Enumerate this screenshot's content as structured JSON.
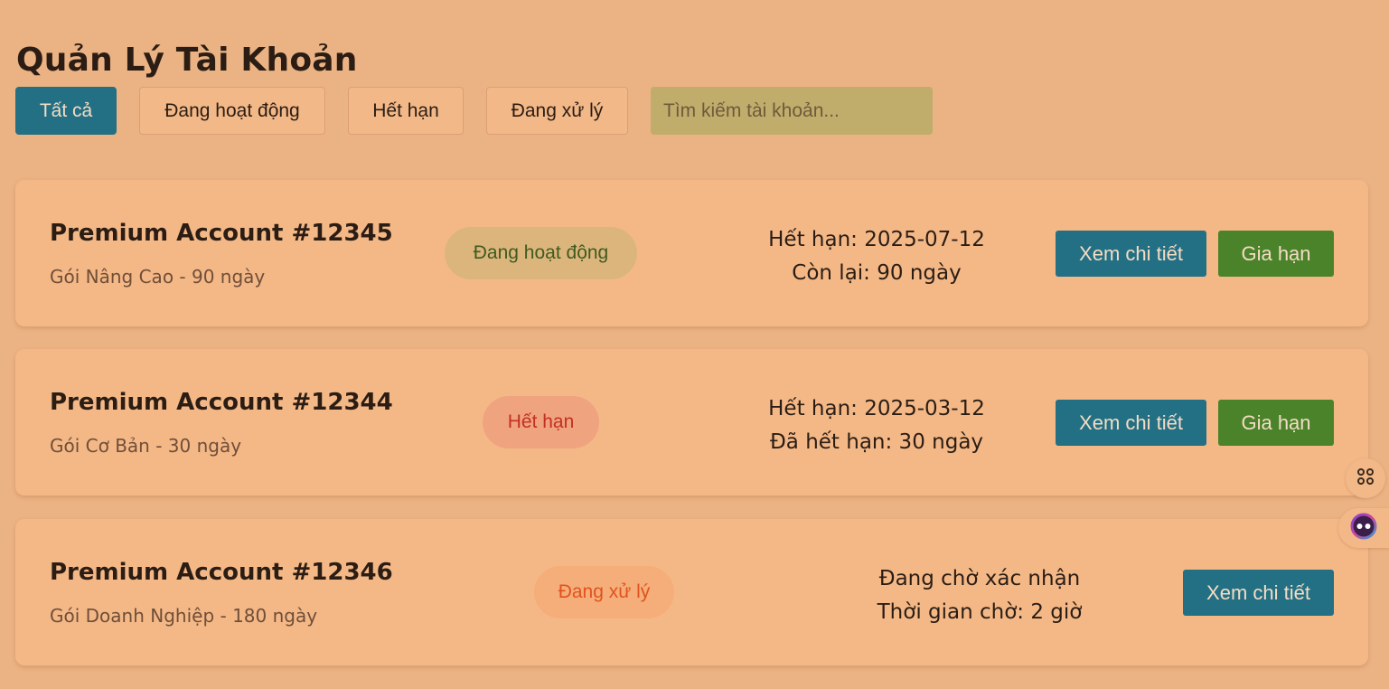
{
  "header": {
    "title": "Quản Lý Tài Khoản"
  },
  "filters": {
    "items": [
      {
        "label": "Tất cả",
        "active": true
      },
      {
        "label": "Đang hoạt động",
        "active": false
      },
      {
        "label": "Hết hạn",
        "active": false
      },
      {
        "label": "Đang xử lý",
        "active": false
      }
    ],
    "search_placeholder": "Tìm kiếm tài khoản..."
  },
  "accounts": [
    {
      "title": "Premium Account #12345",
      "plan": "Gói Nâng Cao - 90 ngày",
      "status": "Đang hoạt động",
      "status_type": "active",
      "info_line1": "Hết hạn: 2025-07-12",
      "info_line2": "Còn lại: 90 ngày",
      "detail_label": "Xem chi tiết",
      "renew_label": "Gia hạn"
    },
    {
      "title": "Premium Account #12344",
      "plan": "Gói Cơ Bản - 30 ngày",
      "status": "Hết hạn",
      "status_type": "expired",
      "info_line1": "Hết hạn: 2025-03-12",
      "info_line2": "Đã hết hạn: 30 ngày",
      "detail_label": "Xem chi tiết",
      "renew_label": "Gia hạn"
    },
    {
      "title": "Premium Account #12346",
      "plan": "Gói Doanh Nghiệp - 180 ngày",
      "status": "Đang xử lý",
      "status_type": "pending",
      "info_line1": "Đang chờ xác nhận",
      "info_line2": "Thời gian chờ: 2 giờ",
      "detail_label": "Xem chi tiết"
    }
  ],
  "side_tools": [
    {
      "icon": "apps-grid-icon"
    },
    {
      "icon": "assistant-face-icon"
    }
  ],
  "colors": {
    "background": "#ebb283",
    "card": "#f4b887",
    "primary": "#237085",
    "success": "#4b832b",
    "search": "#c0ac6b",
    "status_active_text": "#3f5b1e",
    "status_expired_text": "#c23024",
    "status_pending_text": "#e0531f"
  }
}
